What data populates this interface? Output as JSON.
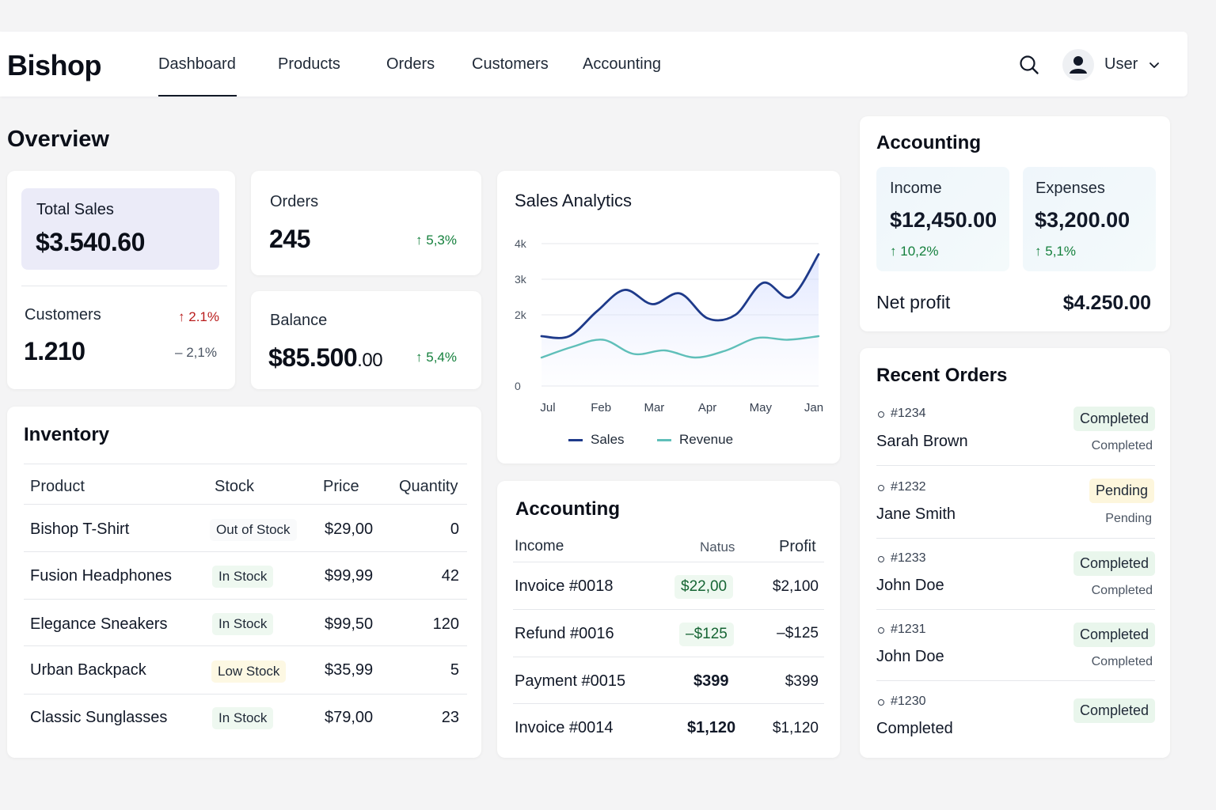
{
  "brand": "Bishop",
  "nav": [
    {
      "label": "Dashboard",
      "active": true
    },
    {
      "label": "Products"
    },
    {
      "label": "Orders"
    },
    {
      "label": "Customers"
    },
    {
      "label": "Accounting"
    }
  ],
  "header": {
    "user_label": "User",
    "icons": [
      "search-icon",
      "avatar-icon",
      "chevron-down-icon"
    ]
  },
  "overview": {
    "title": "Overview",
    "total_sales": {
      "label": "Total Sales",
      "value": "$3.540.60"
    },
    "orders": {
      "label": "Orders",
      "value": "245",
      "delta": "5,3%"
    },
    "customers": {
      "label": "Customers",
      "value": "1.210",
      "delta_up": "2.1%",
      "delta_down": "2,1%"
    },
    "balance": {
      "label": "Balance",
      "value_main": "$85.500",
      "value_cents": ".00",
      "delta": "5,4%"
    }
  },
  "inventory": {
    "title": "Inventory",
    "columns": [
      "Product",
      "Stock",
      "Price",
      "Quantity"
    ],
    "rows": [
      {
        "product": "Bishop T-Shirt",
        "stock": "Out of Stock",
        "status": "out",
        "price": "$29,00",
        "quantity": "0"
      },
      {
        "product": "Fusion Headphones",
        "stock": "In Stock",
        "status": "in",
        "price": "$99,99",
        "quantity": "42"
      },
      {
        "product": "Elegance Sneakers",
        "stock": "In Stock",
        "status": "in",
        "price": "$99,50",
        "quantity": "120"
      },
      {
        "product": "Urban Backpack",
        "stock": "Low Stock",
        "status": "low",
        "price": "$35,99",
        "quantity": "5"
      },
      {
        "product": "Classic Sunglasses",
        "stock": "In Stock",
        "status": "in",
        "price": "$79,00",
        "quantity": "23"
      }
    ]
  },
  "chart_data": {
    "type": "line",
    "title": "Sales Analytics",
    "categories": [
      "Jul",
      "Feb",
      "Mar",
      "Apr",
      "May",
      "Jan"
    ],
    "y_ticks": [
      "0",
      "2k",
      "3k",
      "4k"
    ],
    "ylim": [
      0,
      4000
    ],
    "series": [
      {
        "name": "Sales",
        "color": "#1e3a8a",
        "values": [
          1400,
          1400,
          2100,
          2700,
          2300,
          2600,
          1900,
          2000,
          2900,
          2500,
          3700
        ]
      },
      {
        "name": "Revenue",
        "color": "#5fbfb9",
        "values": [
          800,
          1100,
          1300,
          900,
          1000,
          800,
          1000,
          1350,
          1300,
          1400
        ]
      }
    ],
    "legend": "bottom",
    "grid": true
  },
  "accounting_table": {
    "title": "Accounting",
    "columns": [
      "Income",
      "Natus",
      "Profit"
    ],
    "rows": [
      {
        "income": "Invoice  #0018",
        "natus": "$22,00",
        "natus_style": "green-pill",
        "profit": "$2,100"
      },
      {
        "income": "Refund  #0016",
        "natus": "–$125",
        "natus_style": "green-pill",
        "profit": "–$125"
      },
      {
        "income": "Payment  #0015",
        "natus": "$399",
        "natus_style": "bold",
        "profit": "$399"
      },
      {
        "income": "Invoice  #0014",
        "natus": "$1,120",
        "natus_style": "bold",
        "profit": "$1,120"
      }
    ]
  },
  "accounting_summary": {
    "title": "Accounting",
    "income": {
      "label": "Income",
      "value": "$12,450.00",
      "delta": "10,2%"
    },
    "expenses": {
      "label": "Expenses",
      "value": "$3,200.00",
      "delta": "5,1%"
    },
    "net_profit": {
      "label": "Net profit",
      "value": "$4.250.00"
    }
  },
  "recent_orders": {
    "title": "Recent Orders",
    "items": [
      {
        "id": "#1234",
        "name": "Sarah Brown",
        "badge": "Completed",
        "sub": "Completed",
        "kind": "completed"
      },
      {
        "id": "#1232",
        "name": "Jane Smith",
        "badge": "Pending",
        "sub": "Pending",
        "kind": "pending"
      },
      {
        "id": "#1233",
        "name": "John Doe",
        "badge": "Completed",
        "sub": "Completed",
        "kind": "completed"
      },
      {
        "id": "#1231",
        "name": "John Doe",
        "badge": "Completed",
        "sub": "Completed",
        "kind": "completed"
      },
      {
        "id": "#1230",
        "name": "Completed",
        "badge": "Completed",
        "sub": "",
        "kind": "completed"
      }
    ]
  }
}
